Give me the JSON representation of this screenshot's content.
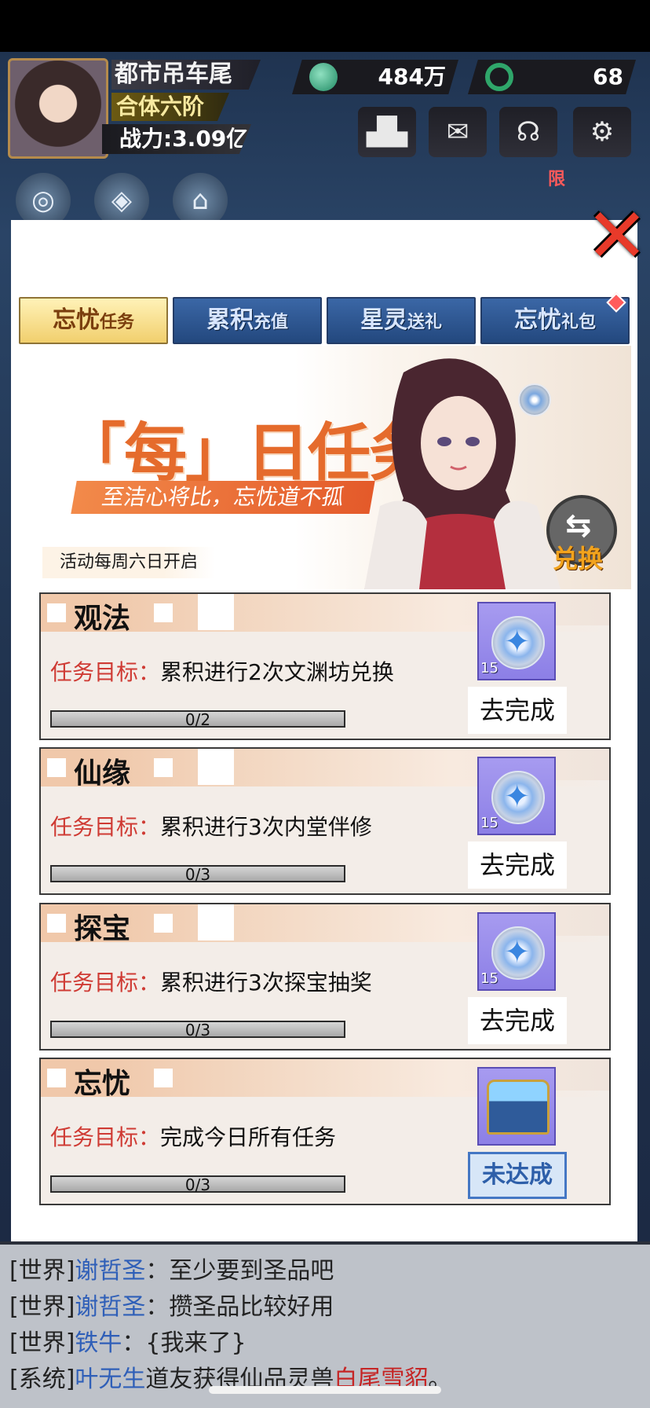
{
  "hud": {
    "player_name": "都市吊车尾",
    "rank": "合体六阶",
    "power": "战力:3.09亿",
    "jade": "484万",
    "orbs": "68",
    "limited_badge": "限"
  },
  "tabs": [
    {
      "big": "忘忧",
      "small": "任务"
    },
    {
      "big": "累积",
      "small": "充值"
    },
    {
      "big": "星灵",
      "small": "送礼"
    },
    {
      "big": "忘忧",
      "small": "礼包"
    }
  ],
  "banner": {
    "title": "「每」日任务",
    "subtitle": "至洁心将比，忘忧道不孤",
    "exchange_glyph": "⇆",
    "exchange_label": "兑换",
    "note": "活动每周六日开启"
  },
  "goal_label": "任务目标：",
  "tasks": [
    {
      "title": "观法",
      "goal": "累积进行2次文渊坊兑换",
      "progress": "0/2",
      "progress_fraction": 0,
      "reward_qty": "15",
      "action": "去完成"
    },
    {
      "title": "仙缘",
      "goal": "累积进行3次内堂伴修",
      "progress": "0/3",
      "progress_fraction": 0,
      "reward_qty": "15",
      "action": "去完成"
    },
    {
      "title": "探宝",
      "goal": "累积进行3次探宝抽奖",
      "progress": "0/3",
      "progress_fraction": 0,
      "reward_qty": "15",
      "action": "去完成"
    },
    {
      "title": "忘忧",
      "goal": "完成今日所有任务",
      "progress": "0/3",
      "progress_fraction": 0,
      "action": "未达成"
    }
  ],
  "chat": [
    {
      "channel": "[世界]",
      "who": "谢哲圣",
      "sep": "：",
      "text": "至少要到圣品吧"
    },
    {
      "channel": "[世界]",
      "who": "谢哲圣",
      "sep": "：",
      "text": "攒圣品比较好用"
    },
    {
      "channel": "[世界]",
      "who": "铁牛",
      "sep": "：",
      "text": "{我来了}"
    },
    {
      "channel": "[系统]",
      "who": "叶无生",
      "text": "道友获得仙品灵兽",
      "pet": "白尾雪貂",
      "end": "。"
    }
  ]
}
